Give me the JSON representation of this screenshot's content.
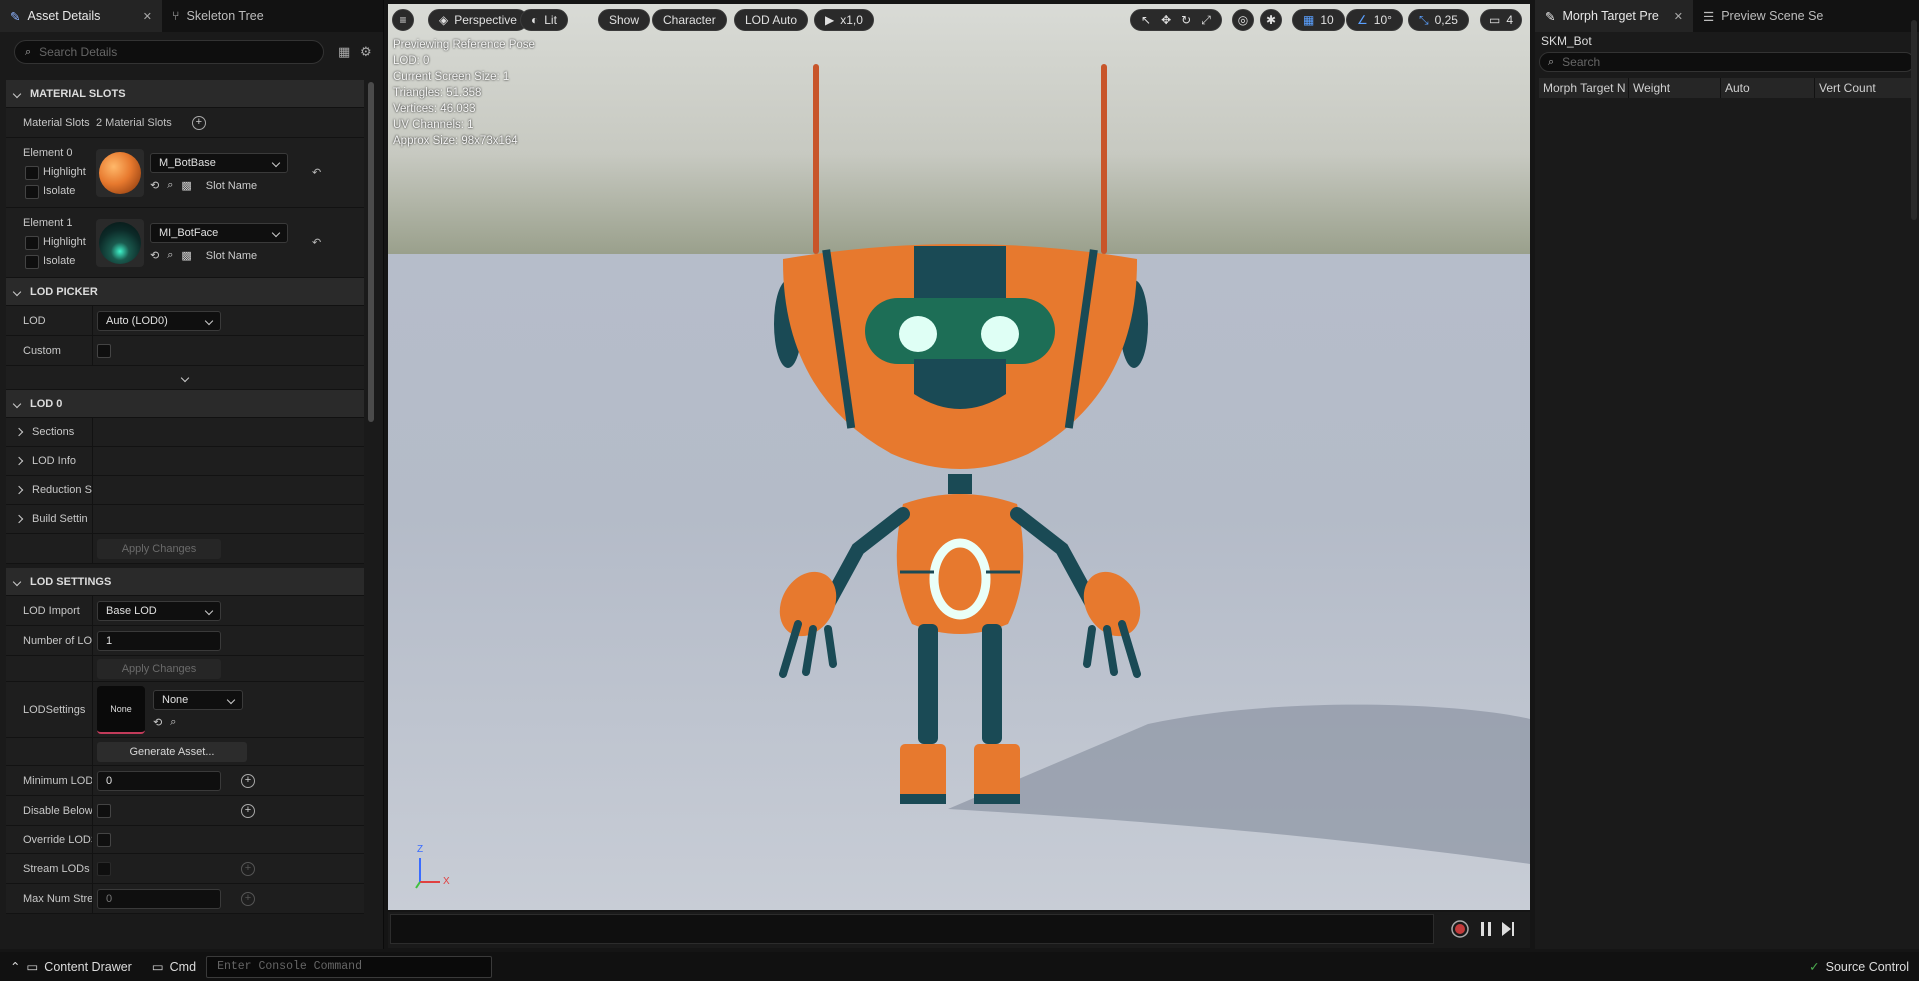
{
  "left_panel": {
    "tabs": [
      {
        "label": "Asset Details",
        "active": true
      },
      {
        "label": "Skeleton Tree",
        "active": false
      }
    ],
    "search": {
      "placeholder": "Search Details"
    },
    "material_slots": {
      "title": "MATERIAL SLOTS",
      "row_label": "Material Slots",
      "count_text": "2 Material Slots",
      "elements": [
        {
          "label": "Element 0",
          "material": "M_BotBase",
          "highlight": "Highlight",
          "isolate": "Isolate",
          "slot_name": "Slot Name"
        },
        {
          "label": "Element 1",
          "material": "MI_BotFace",
          "highlight": "Highlight",
          "isolate": "Isolate",
          "slot_name": "Slot Name"
        }
      ]
    },
    "lod_picker": {
      "title": "LOD PICKER",
      "lod_label": "LOD",
      "lod_value": "Auto (LOD0)",
      "custom_label": "Custom"
    },
    "lod0": {
      "title": "LOD 0",
      "items": [
        "Sections",
        "LOD Info",
        "Reduction S",
        "Build Settin"
      ],
      "apply": "Apply Changes"
    },
    "lod_settings": {
      "title": "LOD SETTINGS",
      "lod_import_label": "LOD Import",
      "lod_import_value": "Base LOD",
      "num_lod_label": "Number of LOD",
      "num_lod_value": "1",
      "apply": "Apply Changes",
      "lodsettings_label": "LODSettings",
      "lodsettings_thumb": "None",
      "lodsettings_value": "None",
      "generate": "Generate Asset...",
      "min_lod_label": "Minimum LOD",
      "min_lod_value": "0",
      "disable_below_label": "Disable Below",
      "override_label": "Override LODS",
      "stream_label": "Stream LODs",
      "maxnum_label": "Max Num Stre",
      "maxnum_value": "0"
    }
  },
  "viewport": {
    "toolbar": {
      "perspective": "Perspective",
      "lit": "Lit",
      "show": "Show",
      "character": "Character",
      "lod": "LOD Auto",
      "play": "x1,0",
      "grid": "10",
      "angle": "10°",
      "scale": "0,25",
      "camera": "4"
    },
    "stats": [
      "Previewing Reference Pose",
      "LOD: 0",
      "Current Screen Size: 1",
      "Triangles: 51.358",
      "Vertices: 46.033",
      "UV Channels: 1",
      "Approx Size: 98x73x164"
    ],
    "axis": {
      "x": "X",
      "z": "Z"
    }
  },
  "right_panel": {
    "tabs": [
      {
        "label": "Morph Target Pre",
        "active": true
      },
      {
        "label": "Preview Scene Se",
        "active": false
      }
    ],
    "asset_name": "SKM_Bot",
    "search": {
      "placeholder": "Search"
    },
    "columns": [
      "Morph Target N",
      "Weight",
      "Auto",
      "Vert Count"
    ]
  },
  "status_bar": {
    "content_drawer": "Content Drawer",
    "cmd": "Cmd",
    "console_placeholder": "Enter Console Command",
    "source_control": "Source Control"
  },
  "colors": {
    "accent_orange": "#e7792e",
    "teal_dark": "#1a4a55",
    "glow": "#3ff2c9",
    "record_red": "#c23b3b",
    "source_control_green": "#4caf50"
  }
}
